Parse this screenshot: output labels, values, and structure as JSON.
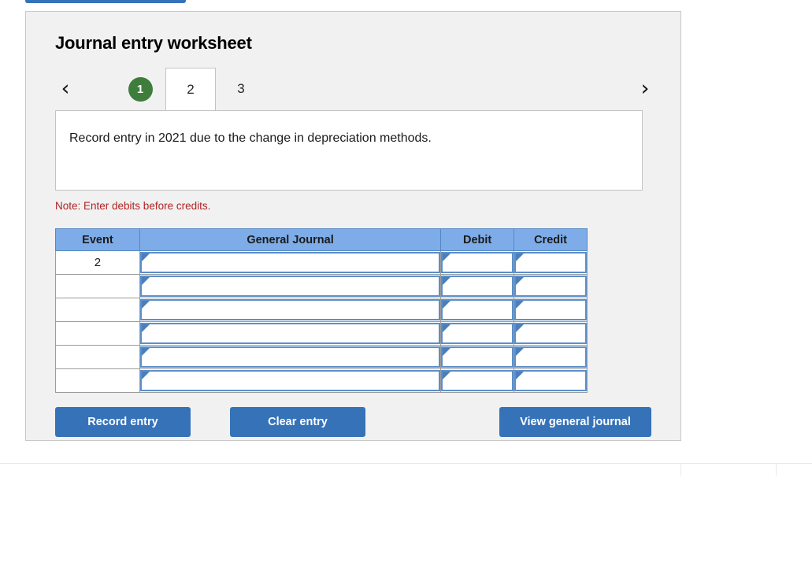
{
  "worksheet": {
    "title": "Journal entry worksheet",
    "prev_arrow": "‹",
    "next_arrow": "›",
    "tabs": [
      {
        "label": "1",
        "state": "completed"
      },
      {
        "label": "2",
        "state": "active"
      },
      {
        "label": "3",
        "state": "inactive"
      }
    ],
    "description": "Record entry in 2021 due to the change in depreciation methods.",
    "note": "Note: Enter debits before credits."
  },
  "table": {
    "headers": [
      "Event",
      "General Journal",
      "Debit",
      "Credit"
    ],
    "rows": [
      {
        "event": "2",
        "general_journal": "",
        "debit": "",
        "credit": ""
      },
      {
        "event": "",
        "general_journal": "",
        "debit": "",
        "credit": ""
      },
      {
        "event": "",
        "general_journal": "",
        "debit": "",
        "credit": ""
      },
      {
        "event": "",
        "general_journal": "",
        "debit": "",
        "credit": ""
      },
      {
        "event": "",
        "general_journal": "",
        "debit": "",
        "credit": ""
      },
      {
        "event": "",
        "general_journal": "",
        "debit": "",
        "credit": ""
      }
    ]
  },
  "actions": {
    "record_entry": "Record entry",
    "clear_entry": "Clear entry",
    "view_general_journal": "View general journal"
  },
  "colors": {
    "panel_bg": "#F1F1F1",
    "button_blue": "#3572B8",
    "header_blue": "#7DACE8",
    "completed_green": "#3E7D3C",
    "note_red": "#B22222",
    "cell_border_blue": "#5B8FCB"
  }
}
